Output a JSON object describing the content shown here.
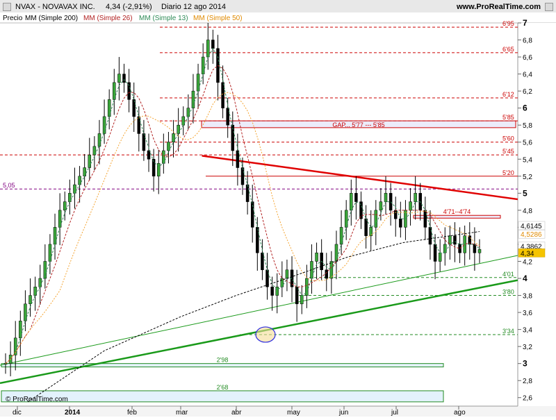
{
  "header": {
    "title": "NVAX - NOVAVAX INC.",
    "price": "4,34 (-2,91%)",
    "period": "Diario 12 ago 2014",
    "site": "www.ProRealTime.com"
  },
  "legend": [
    {
      "label": "Precio",
      "color": "#000000"
    },
    {
      "label": "MM (Simple 200)",
      "color": "#000000"
    },
    {
      "label": "MM (Simple 26)",
      "color": "#b22222"
    },
    {
      "label": "MM (Simple 13)",
      "color": "#2e8b57"
    },
    {
      "label": "MM (Simple 50)",
      "color": "#f4a431"
    }
  ],
  "watermark": "© ProRealTime.com",
  "chart_data": {
    "type": "candlestick",
    "y_axis": {
      "min": 2.5,
      "max": 7.0,
      "ticks": [
        "2,6",
        "2,8",
        "3",
        "3,2",
        "3,4",
        "3,6",
        "3,8",
        "4",
        "4,2",
        "4,4",
        "4,6",
        "4,8",
        "5",
        "5,2",
        "5,4",
        "5,6",
        "5,8",
        "6",
        "6,2",
        "6,4",
        "6,6",
        "6,8",
        "7"
      ]
    },
    "x_axis": {
      "labels": [
        "dic",
        "2014",
        "feb",
        "mar",
        "abr",
        "may",
        "jun",
        "jul",
        "ago"
      ]
    },
    "price_tags": [
      {
        "value": 4.6145,
        "label": "4,6145",
        "color": "#ffffff",
        "text": "#000000"
      },
      {
        "value": 4.5286,
        "label": "4,5286",
        "color": "#ffffff",
        "text": "#e08a00"
      },
      {
        "value": 4.3862,
        "label": "4,3862",
        "color": "#ffffff",
        "text": "#000000"
      },
      {
        "value": 4.34,
        "label": "4,34",
        "color": "#f5c400",
        "text": "#000000"
      }
    ],
    "level_lines": [
      {
        "value": 6.95,
        "label": "6'95",
        "color": "#cc0000",
        "dash": true
      },
      {
        "value": 6.65,
        "label": "6'65",
        "color": "#cc0000",
        "dash": true
      },
      {
        "value": 6.12,
        "label": "6'12",
        "color": "#cc0000",
        "dash": true
      },
      {
        "value": 5.85,
        "label": "5'85",
        "color": "#cc0000",
        "dash": true
      },
      {
        "value": 5.6,
        "label": "5'60",
        "color": "#cc0000",
        "dash": true
      },
      {
        "value": 5.45,
        "label": "5'45",
        "color": "#cc0000",
        "dash": true
      },
      {
        "value": 5.2,
        "label": "5'20",
        "color": "#cc0000",
        "dash": false
      },
      {
        "value": 5.05,
        "label": "5,05",
        "color": "#800080",
        "dash": true
      },
      {
        "value": 4.01,
        "label": "4'01",
        "color": "#228b22",
        "dash": true
      },
      {
        "value": 3.8,
        "label": "3'80",
        "color": "#228b22",
        "dash": true
      },
      {
        "value": 3.34,
        "label": "3'34",
        "color": "#228b22",
        "dash": true
      }
    ],
    "zones": [
      {
        "low": 5.77,
        "high": 5.85,
        "label": "GAP... 5'77 --- 5'85",
        "color": "#cc0000"
      },
      {
        "low": 4.71,
        "high": 4.74,
        "label": "4'71--4'74",
        "color": "#cc0000"
      },
      {
        "low": 2.96,
        "high": 3.0,
        "label": "2'98",
        "color": "#228b22"
      },
      {
        "low": 2.55,
        "high": 2.68,
        "label": "2'68",
        "color": "#228b22"
      }
    ],
    "trendlines": [
      {
        "name": "resistance",
        "from": [
          0.39,
          5.44
        ],
        "to": [
          0.93,
          4.88
        ],
        "color": "#e00000"
      },
      {
        "name": "support",
        "from": [
          0.0,
          2.77
        ],
        "to": [
          0.93,
          3.93
        ],
        "color": "#1a9a1a"
      },
      {
        "name": "channel",
        "from": [
          0.0,
          2.98
        ],
        "to": [
          0.93,
          4.22
        ],
        "color": "#1a9a1a"
      }
    ],
    "closes": [
      3.0,
      3.1,
      3.3,
      3.5,
      3.7,
      3.8,
      3.9,
      4.0,
      4.2,
      4.4,
      4.6,
      4.8,
      4.9,
      5.0,
      5.1,
      5.2,
      5.3,
      5.45,
      5.55,
      5.7,
      5.9,
      6.1,
      6.3,
      6.4,
      6.3,
      6.1,
      5.9,
      5.7,
      5.5,
      5.4,
      5.2,
      5.35,
      5.5,
      5.6,
      5.7,
      5.8,
      5.9,
      6.0,
      6.2,
      6.4,
      6.6,
      6.8,
      6.7,
      6.3,
      6.0,
      5.8,
      5.5,
      5.3,
      5.1,
      4.9,
      4.6,
      4.3,
      4.1,
      3.9,
      3.8,
      3.9,
      4.0,
      4.1,
      3.9,
      3.7,
      3.8,
      4.0,
      4.2,
      4.3,
      4.1,
      4.0,
      4.2,
      4.4,
      4.6,
      4.8,
      5.0,
      4.9,
      4.7,
      4.5,
      4.6,
      4.8,
      4.9,
      5.0,
      4.8,
      4.7,
      4.6,
      4.8,
      4.9,
      5.0,
      4.8,
      4.6,
      4.4,
      4.2,
      4.3,
      4.4,
      4.5,
      4.4,
      4.3,
      4.5,
      4.4,
      4.3,
      4.34
    ]
  }
}
